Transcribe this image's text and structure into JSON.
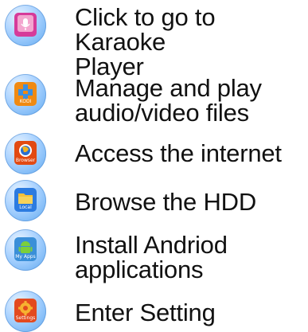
{
  "items": [
    {
      "description": "Click to go to Karaoke\nPlayer",
      "icon_label": "",
      "icon": "microphone-icon",
      "tile_color": "#d63b9a"
    },
    {
      "description": "Manage and play\naudio/video files",
      "icon_label": "KODI",
      "icon": "kodi-icon",
      "tile_color": "#f08a12"
    },
    {
      "description": "Access the internet",
      "icon_label": "Browser",
      "icon": "browser-icon",
      "tile_color": "#e24a12"
    },
    {
      "description": "Browse the HDD",
      "icon_label": "Local",
      "icon": "folder-icon",
      "tile_color": "#2c7be0"
    },
    {
      "description": "Install Andriod\napplications",
      "icon_label": "My Apps",
      "icon": "android-icon",
      "tile_color": "#3a8fd8"
    },
    {
      "description": "Enter Setting",
      "icon_label": "Settings",
      "icon": "settings-icon",
      "tile_color": "#e34a1f"
    }
  ]
}
